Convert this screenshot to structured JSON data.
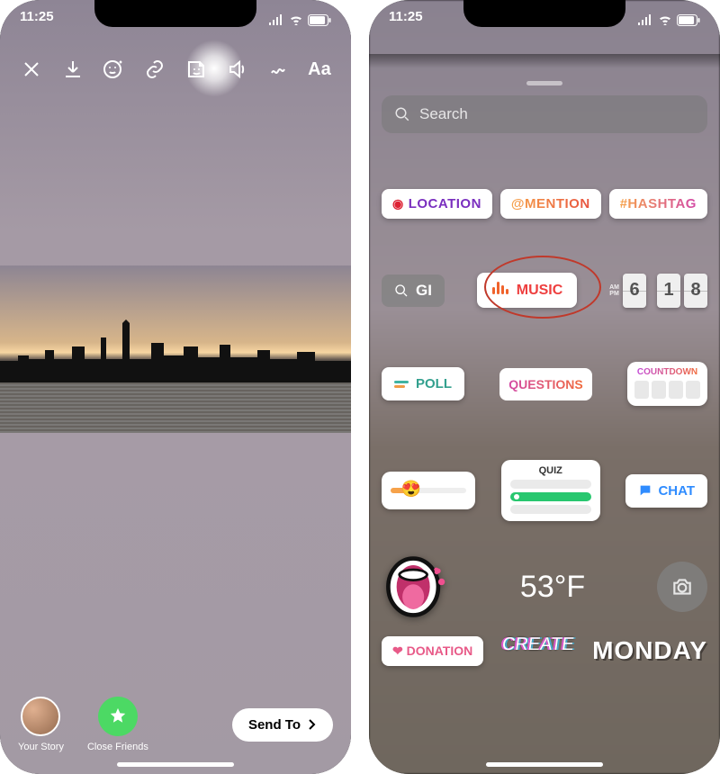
{
  "status": {
    "time": "11:25"
  },
  "left": {
    "bottom": {
      "your_story": "Your Story",
      "close_friends": "Close Friends",
      "send_to": "Send To"
    }
  },
  "right": {
    "search_placeholder": "Search",
    "stickers": {
      "location": "LOCATION",
      "mention": "@MENTION",
      "hashtag": "#HASHTAG",
      "gif": "GI",
      "music": "MUSIC",
      "time": {
        "ampm_top": "AM",
        "ampm_bot": "PM",
        "d1": "6",
        "d2": "1",
        "d3": "8"
      },
      "poll": "POLL",
      "questions": "QUESTIONS",
      "countdown": "COUNTDOWN",
      "quiz": "QUIZ",
      "chat": "CHAT",
      "slider_emoji": "😍",
      "temp": "53°F",
      "donation": "DONATION",
      "create": "CREATE",
      "day": "MONDAY"
    }
  }
}
